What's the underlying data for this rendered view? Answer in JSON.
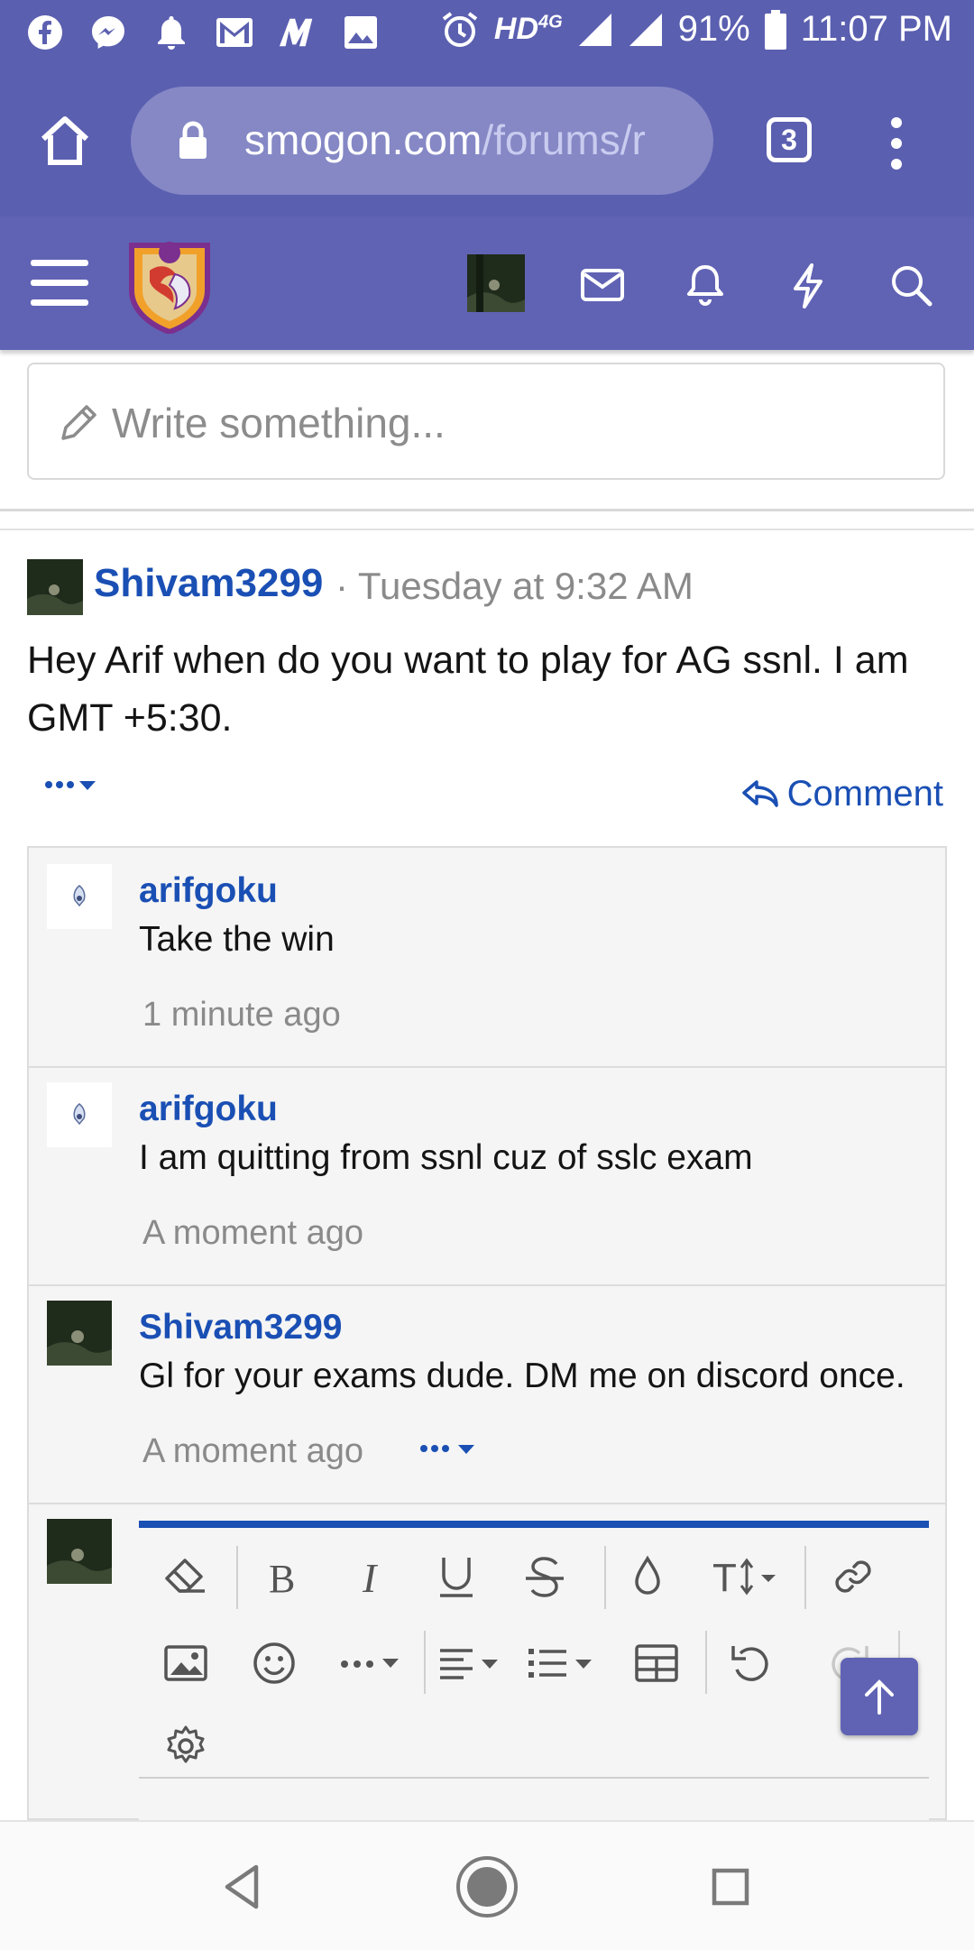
{
  "status_bar": {
    "network": "HD",
    "network_sup": "4G",
    "battery_percent": "91%",
    "time": "11:07 PM"
  },
  "browser": {
    "url_host": "smogon.com",
    "url_path": "/forums/r",
    "tab_count": "3"
  },
  "composer": {
    "placeholder": "Write something..."
  },
  "post": {
    "author": "Shivam3299",
    "separator": "·",
    "time": "Tuesday at 9:32 AM",
    "body": "Hey Arif when do you want to play for AG ssnl. I am GMT +5:30.",
    "more_label": "···",
    "comment_label": "Comment"
  },
  "comments": [
    {
      "author": "arifgoku",
      "text": "Take the win",
      "time": "1 minute ago"
    },
    {
      "author": "arifgoku",
      "text": "I am quitting from ssnl cuz of sslc exam",
      "time": "A moment ago"
    },
    {
      "author": "Shivam3299",
      "text": "Gl for your exams dude. DM me on discord once.",
      "time": "A moment ago",
      "more_label": "···"
    }
  ],
  "colors": {
    "status_bar": "#5b5fb0",
    "site_header": "#6063b4",
    "link": "#1a4fb4",
    "muted": "#8a8a8a"
  },
  "editor_toolbar": {
    "icons": [
      "eraser-icon",
      "bold-icon",
      "italic-icon",
      "underline-icon",
      "strikethrough-icon",
      "text-color-icon",
      "font-size-icon",
      "link-icon",
      "image-icon",
      "smiley-icon",
      "more-options-icon",
      "align-icon",
      "list-icon",
      "table-icon",
      "undo-icon",
      "redo-icon",
      "settings-icon"
    ]
  }
}
